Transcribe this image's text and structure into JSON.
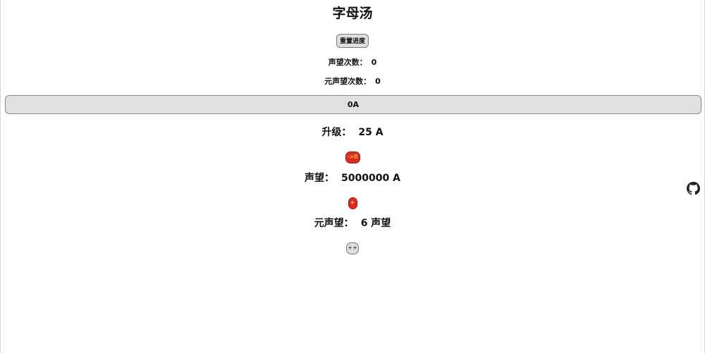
{
  "app": {
    "title": "字母汤"
  },
  "controls": {
    "reset_label": "重置进度"
  },
  "stats": {
    "prestige_count_label": "声望次数：",
    "prestige_count_value": "0",
    "meta_prestige_count_label": "元声望次数：",
    "meta_prestige_count_value": "0"
  },
  "progress": {
    "text": "0A"
  },
  "upgrade": {
    "label": "升级：",
    "value": "25 A",
    "button_label": "->B"
  },
  "prestige": {
    "label": "声望：",
    "value": "5000000 A",
    "button_label": "+"
  },
  "meta_prestige": {
    "label": "元声望：",
    "value": "6 声望",
    "button_label": "++"
  },
  "icons": {
    "github": "github-icon"
  },
  "colors": {
    "action_button_bg": "#dd2b1e",
    "action_button_text": "#ffe36a",
    "neutral_button_bg": "#dedede"
  }
}
